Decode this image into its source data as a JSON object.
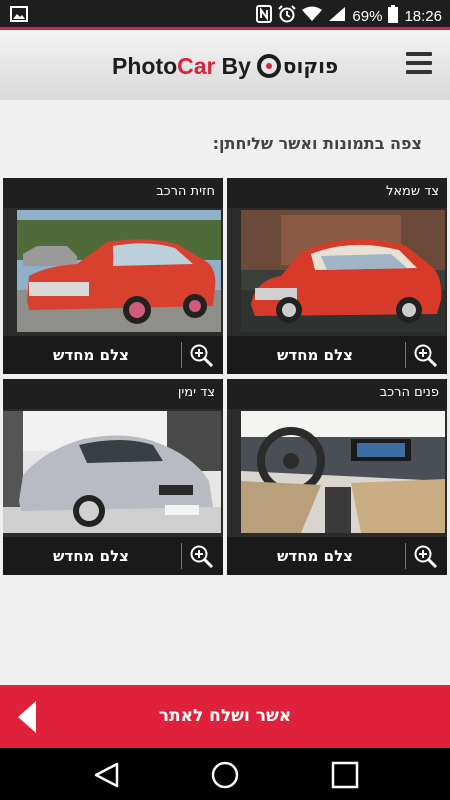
{
  "status_bar": {
    "battery": "69%",
    "time": "18:26",
    "icons": [
      "gallery-icon",
      "nfc-icon",
      "alarm-icon",
      "wifi-icon",
      "signal-icon",
      "battery-icon"
    ]
  },
  "header": {
    "brand_photo": "Photo",
    "brand_car": "Car",
    "brand_by": "By",
    "logo_text": "פוקוס",
    "accent_color": "#d8243a"
  },
  "main": {
    "instruction": "צפה בתמונות ואשר שליחתן:",
    "cards": [
      {
        "title": "צד שמאל",
        "retake_label": "צלם מחדש",
        "image": "red-classic-car-left-side"
      },
      {
        "title": "חזית הרכב",
        "retake_label": "צלם מחדש",
        "image": "red-classic-car-front"
      },
      {
        "title": "פנים הרכב",
        "retake_label": "צלם מחדש",
        "image": "car-interior-dashboard"
      },
      {
        "title": "צד ימין",
        "retake_label": "צלם מחדש",
        "image": "silver-sports-car-right-side"
      }
    ]
  },
  "cta": {
    "label": "אשר ושלח לאתר",
    "color": "#e0213c"
  },
  "nav": {
    "icons": [
      "back-icon",
      "home-icon",
      "recents-icon"
    ]
  }
}
